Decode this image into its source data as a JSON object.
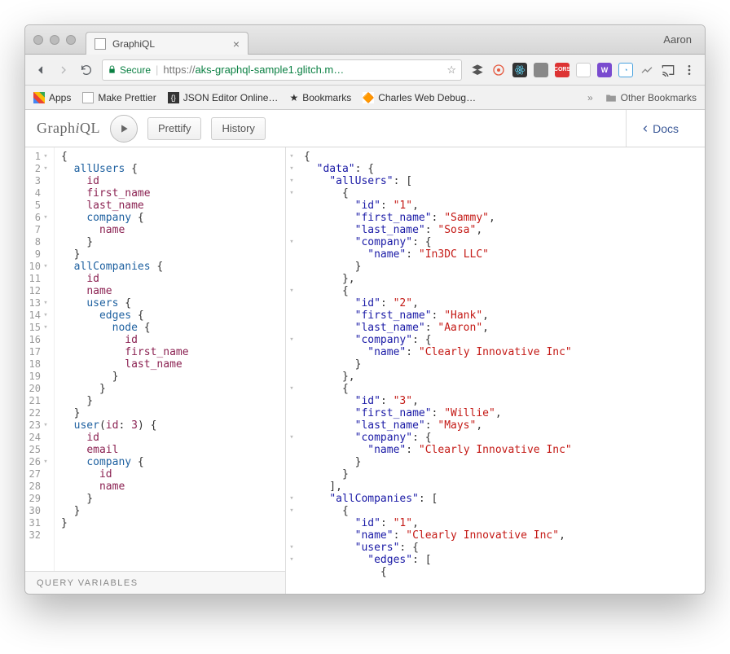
{
  "browser": {
    "tab_title": "GraphiQL",
    "profile": "Aaron",
    "secure_label": "Secure",
    "url_scheme": "https://",
    "url_host": "aks-graphql-sample1.glitch.m…",
    "bookmarks": [
      "Apps",
      "Make Prettier",
      "JSON Editor Online…",
      "Bookmarks",
      "Charles Web Debug…"
    ],
    "other_bookmarks": "Other Bookmarks"
  },
  "graphiql": {
    "prettify": "Prettify",
    "history": "History",
    "docs": "Docs",
    "query_variables": "QUERY VARIABLES"
  },
  "query": {
    "lines": [
      {
        "n": 1,
        "fold": "▾",
        "t": "{"
      },
      {
        "n": 2,
        "fold": "▾",
        "t": "  <k>allUsers</k> {"
      },
      {
        "n": 3,
        "t": "    <a>id</a>"
      },
      {
        "n": 4,
        "t": "    <a>first_name</a>"
      },
      {
        "n": 5,
        "t": "    <a>last_name</a>"
      },
      {
        "n": 6,
        "fold": "▾",
        "t": "    <k>company</k> {"
      },
      {
        "n": 7,
        "t": "      <a>name</a>"
      },
      {
        "n": 8,
        "t": "    }"
      },
      {
        "n": 9,
        "t": "  }"
      },
      {
        "n": 10,
        "fold": "▾",
        "t": "  <k>allCompanies</k> {"
      },
      {
        "n": 11,
        "t": "    <a>id</a>"
      },
      {
        "n": 12,
        "t": "    <a>name</a>"
      },
      {
        "n": 13,
        "fold": "▾",
        "t": "    <k>users</k> {"
      },
      {
        "n": 14,
        "fold": "▾",
        "t": "      <k>edges</k> {"
      },
      {
        "n": 15,
        "fold": "▾",
        "t": "        <k>node</k> {"
      },
      {
        "n": 16,
        "t": "          <a>id</a>"
      },
      {
        "n": 17,
        "t": "          <a>first_name</a>"
      },
      {
        "n": 18,
        "t": "          <a>last_name</a>"
      },
      {
        "n": 19,
        "t": "        }"
      },
      {
        "n": 20,
        "t": "      }"
      },
      {
        "n": 21,
        "t": "    }"
      },
      {
        "n": 22,
        "t": "  }"
      },
      {
        "n": 23,
        "fold": "▾",
        "t": "  <k>user</k>(<a>id</a>: <g>3</g>) {"
      },
      {
        "n": 24,
        "t": "    <a>id</a>"
      },
      {
        "n": 25,
        "t": "    <a>email</a>"
      },
      {
        "n": 26,
        "fold": "▾",
        "t": "    <k>company</k> {"
      },
      {
        "n": 27,
        "t": "      <a>id</a>"
      },
      {
        "n": 28,
        "t": "      <a>name</a>"
      },
      {
        "n": 29,
        "t": "    }"
      },
      {
        "n": 30,
        "t": "  }"
      },
      {
        "n": 31,
        "t": "}"
      },
      {
        "n": 32,
        "t": ""
      }
    ]
  },
  "result": {
    "lines": [
      {
        "fold": "▾",
        "t": "{"
      },
      {
        "fold": "▾",
        "t": "  <p>\"data\"</p>: {"
      },
      {
        "fold": "▾",
        "t": "    <p>\"allUsers\"</p>: ["
      },
      {
        "fold": "▾",
        "t": "      {"
      },
      {
        "t": "        <p>\"id\"</p>: <v>\"1\"</v>,"
      },
      {
        "t": "        <p>\"first_name\"</p>: <v>\"Sammy\"</v>,"
      },
      {
        "t": "        <p>\"last_name\"</p>: <v>\"Sosa\"</v>,"
      },
      {
        "fold": "▾",
        "t": "        <p>\"company\"</p>: {"
      },
      {
        "t": "          <p>\"name\"</p>: <v>\"In3DC LLC\"</v>"
      },
      {
        "t": "        }"
      },
      {
        "t": "      },"
      },
      {
        "fold": "▾",
        "t": "      {"
      },
      {
        "t": "        <p>\"id\"</p>: <v>\"2\"</v>,"
      },
      {
        "t": "        <p>\"first_name\"</p>: <v>\"Hank\"</v>,"
      },
      {
        "t": "        <p>\"last_name\"</p>: <v>\"Aaron\"</v>,"
      },
      {
        "fold": "▾",
        "t": "        <p>\"company\"</p>: {"
      },
      {
        "t": "          <p>\"name\"</p>: <v>\"Clearly Innovative Inc\"</v>"
      },
      {
        "t": "        }"
      },
      {
        "t": "      },"
      },
      {
        "fold": "▾",
        "t": "      {"
      },
      {
        "t": "        <p>\"id\"</p>: <v>\"3\"</v>,"
      },
      {
        "t": "        <p>\"first_name\"</p>: <v>\"Willie\"</v>,"
      },
      {
        "t": "        <p>\"last_name\"</p>: <v>\"Mays\"</v>,"
      },
      {
        "fold": "▾",
        "t": "        <p>\"company\"</p>: {"
      },
      {
        "t": "          <p>\"name\"</p>: <v>\"Clearly Innovative Inc\"</v>"
      },
      {
        "t": "        }"
      },
      {
        "t": "      }"
      },
      {
        "t": "    ],"
      },
      {
        "fold": "▾",
        "t": "    <p>\"allCompanies\"</p>: ["
      },
      {
        "fold": "▾",
        "t": "      {"
      },
      {
        "t": "        <p>\"id\"</p>: <v>\"1\"</v>,"
      },
      {
        "t": "        <p>\"name\"</p>: <v>\"Clearly Innovative Inc\"</v>,"
      },
      {
        "fold": "▾",
        "t": "        <p>\"users\"</p>: {"
      },
      {
        "fold": "▾",
        "t": "          <p>\"edges\"</p>: ["
      },
      {
        "t": "            {"
      }
    ]
  }
}
